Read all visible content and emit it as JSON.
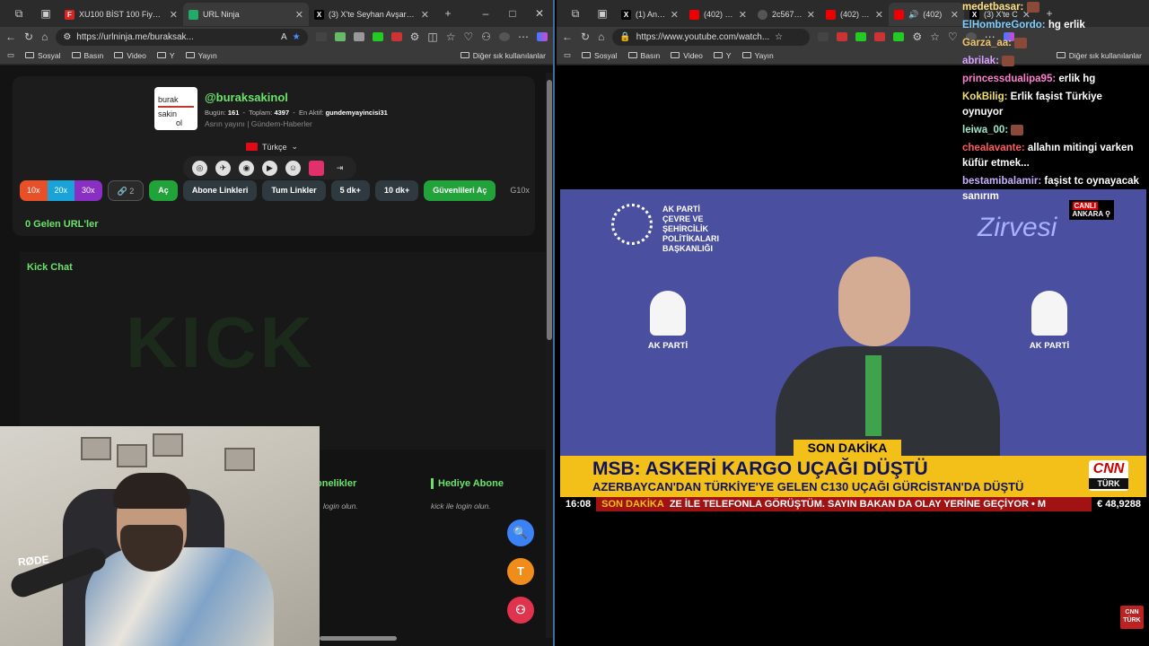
{
  "left_browser": {
    "tabs": [
      {
        "label": "XU100 BİST 100 Fiyatı ve Gr",
        "fav_color": "#d22",
        "fav_text": "F",
        "active": false
      },
      {
        "label": "URL Ninja",
        "fav_color": "#2a6",
        "fav_text": "",
        "active": true
      },
      {
        "label": "(3) X'te Seyhan Avşar: \"Başı",
        "fav_color": "#000",
        "fav_text": "X",
        "active": false
      }
    ],
    "url": "https://urlninja.me/buraksak...",
    "bookmarks": [
      "Sosyal",
      "Basın",
      "Video",
      "Y",
      "Yayın"
    ],
    "bookmarks_right": "Diğer sık kullanılanlar"
  },
  "right_browser": {
    "tabs": [
      {
        "label": "(1) Anasay",
        "fav_color": "#000",
        "fav_text": "X"
      },
      {
        "label": "(402) HAL",
        "fav_color": "#e00",
        "fav_text": ""
      },
      {
        "label": "2c5673b4",
        "fav_color": "#555",
        "fav_text": ""
      },
      {
        "label": "(402) SÖZ",
        "fav_color": "#e00",
        "fav_text": ""
      },
      {
        "label": "(402)",
        "fav_color": "#e00",
        "fav_text": ""
      },
      {
        "label": "(3) X'te C",
        "fav_color": "#000",
        "fav_text": "X"
      }
    ],
    "url": "https://www.youtube.com/watch...",
    "bookmarks": [
      "Sosyal",
      "Basın",
      "Video",
      "Y",
      "Yayın"
    ],
    "bookmarks_right": "Diğer sık kullanılanlar"
  },
  "profile": {
    "handle": "@buraksakinol",
    "today_label": "Bugün:",
    "today": "161",
    "total_label": "Toplam:",
    "total": "4397",
    "active_label": "En Aktif:",
    "active": "gundemyayincisi31",
    "subtitle": "Asrın yayını | Gündem-Haberler",
    "language": "Türkçe",
    "logo_lines": [
      "burak",
      "sakin",
      "ol"
    ]
  },
  "buttons": {
    "x10": "10x",
    "x20": "20x",
    "x30": "30x",
    "links": "2",
    "open": "Aç",
    "sub_links": "Abone Linkleri",
    "all_links": "Tum Linkler",
    "five_plus": "5 dk+",
    "ten_plus": "10 dk+",
    "open_safe": "Güvenlileri Aç",
    "g10x": "G10x",
    "cut": "G"
  },
  "gelen": "0 Gelen URL'ler",
  "kick_chat": "Kick Chat",
  "kick_watermark": "KICK",
  "abonelikler": "onelikler",
  "abonelikler_sub": "login olun.",
  "hediye": "Hediye Abone",
  "hediye_sub": "kick ile login olun.",
  "fabs": {
    "search": "🔍",
    "t": "T",
    "user": "⚇"
  },
  "webcam": {
    "brand": "RØDE"
  },
  "video": {
    "ministry_lines": [
      "AK PARTİ",
      "ÇEVRE VE",
      "ŞEHİRCİLİK",
      "POLİTİKALARI",
      "BAŞKANLIĞI"
    ],
    "zirvesi": "Zirvesi",
    "party": "AK PARTİ",
    "live": "CANLI",
    "city": "ANKARA"
  },
  "news": {
    "tag": "SON DAKİKA",
    "headline": "MSB: ASKERİ KARGO UÇAĞI DÜŞTÜ",
    "subline": "AZERBAYCAN'DAN TÜRKİYE'YE GELEN C130 UÇAĞI GÜRCİSTAN'DA DÜŞTÜ",
    "time": "16:08",
    "ticker_tag": "SON DAKİKA",
    "ticker": "ZE İLE TELEFONLA GÖRÜŞTÜM. SAYIN BAKAN DA OLAY YERİNE GEÇİYOR",
    "ticker_end": "M",
    "currency": "€  48,9288",
    "cnn1": "CNN",
    "cnn2": "TÜRK"
  },
  "chat": [
    {
      "user": "medetbasar:",
      "text": "",
      "color": "#ffe082"
    },
    {
      "user": "ElHombreGordo:",
      "text": "hg erlik",
      "color": "#7fd0ff"
    },
    {
      "user": "Garza_aa:",
      "text": "",
      "color": "#f0c26b"
    },
    {
      "user": "abrilak:",
      "text": "",
      "color": "#d8a0ff"
    },
    {
      "user": "princessdualipa95:",
      "text": "erlik hg",
      "color": "#ff7fd0"
    },
    {
      "user": "KokBilig:",
      "text": "Erlik faşist Türkiye oynuyor",
      "color": "#f0e06b"
    },
    {
      "user": "leiwa_00:",
      "text": "",
      "color": "#9fe6c8"
    },
    {
      "user": "chealavante:",
      "text": "allahın mitingi varken küfür etmek...",
      "color": "#ff5a5a"
    },
    {
      "user": "bestamibalamir:",
      "text": "faşist tc oynayacak sanırım",
      "color": "#c9b0ff"
    }
  ]
}
